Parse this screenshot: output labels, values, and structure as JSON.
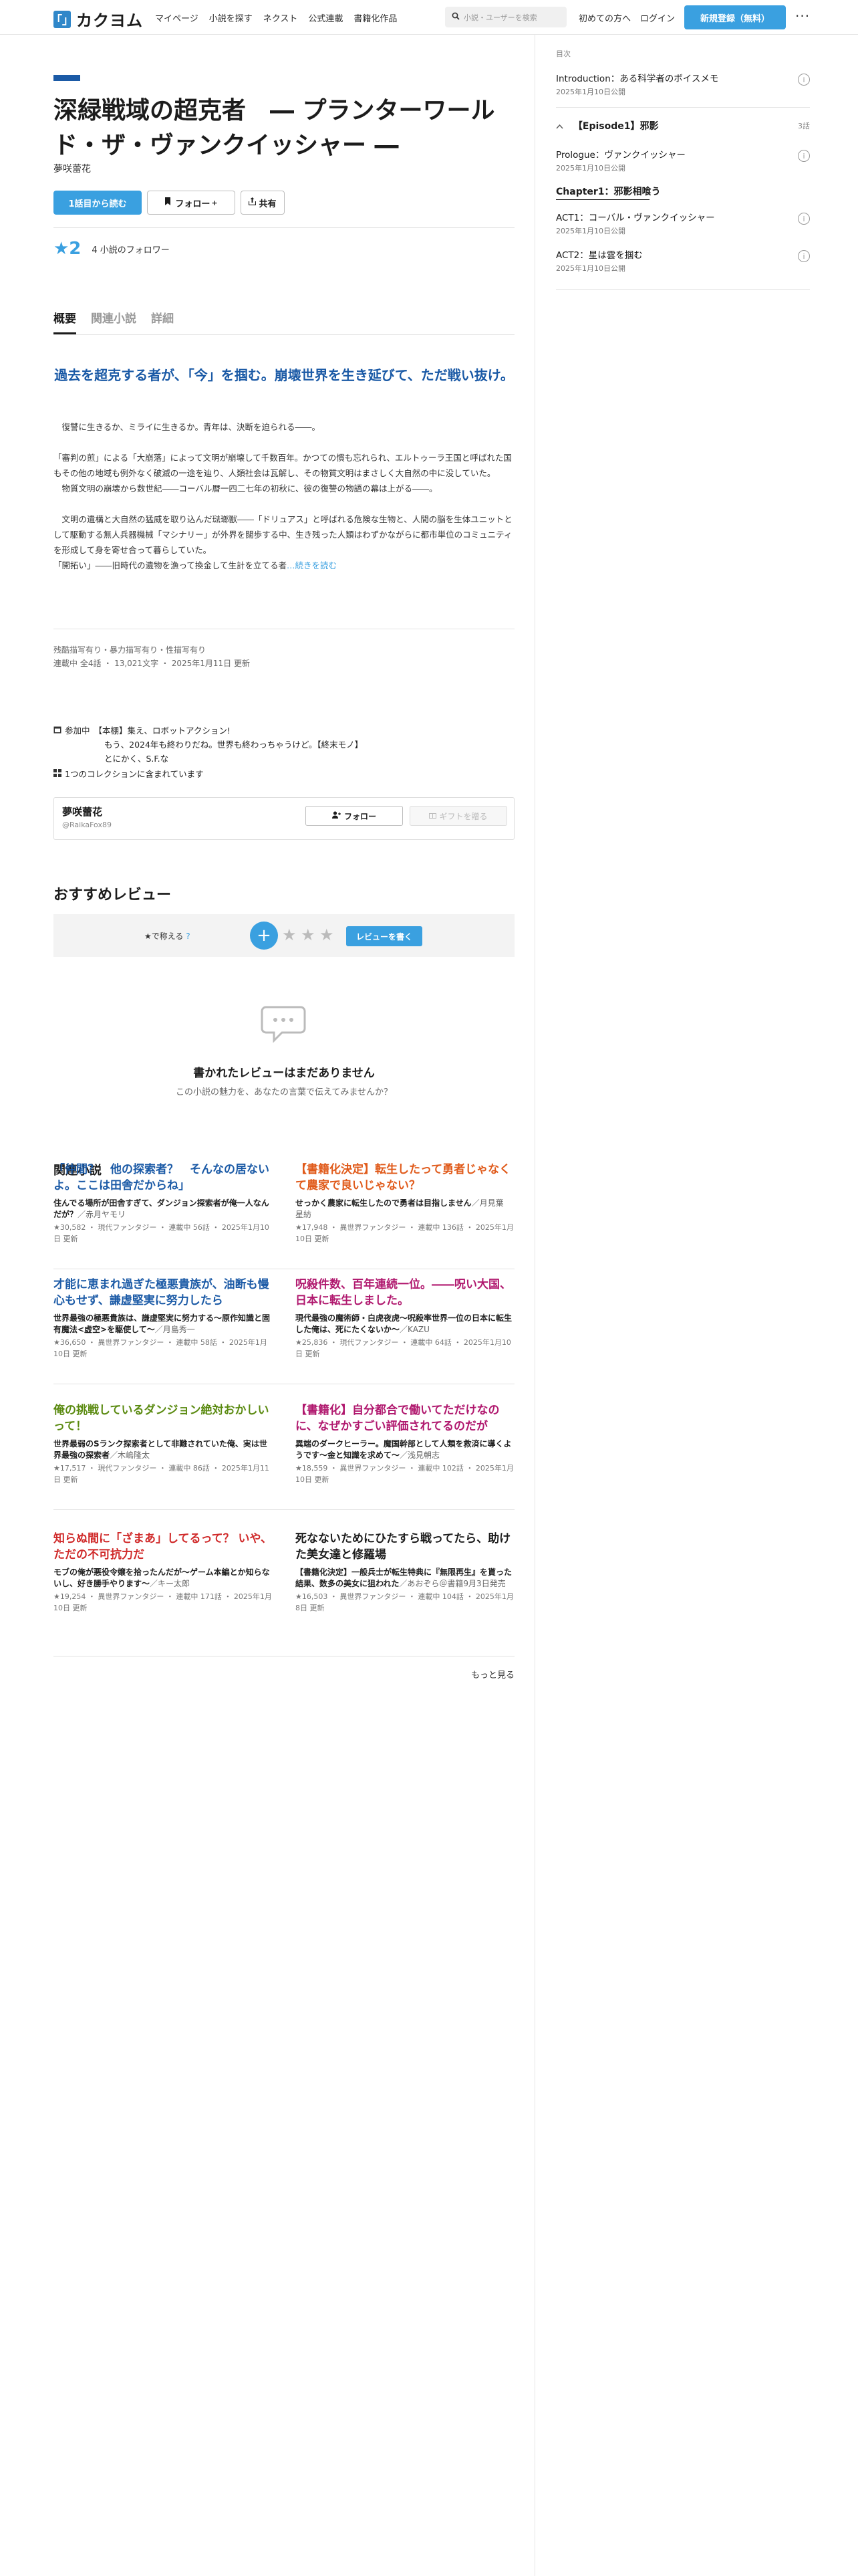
{
  "header": {
    "logo_mark": "「」",
    "logo_text": "カクヨム",
    "nav": [
      "マイページ",
      "小説を探す",
      "ネクスト",
      "公式連載",
      "書籍化作品"
    ],
    "search_placeholder": "小説・ユーザーを検索",
    "beginner": "初めての方へ",
    "login": "ログイン",
    "register": "新規登録（無料）",
    "more": "···"
  },
  "work": {
    "title": "深緑戦域の超克者　― プランターワールド・ザ・ヴァンクイッシャー ―",
    "author": "夢咲蕾花",
    "read_first": "1話目から読む",
    "follow": "フォロー",
    "share": "共有",
    "stars": "★2",
    "followers": "4 小説のフォロワー"
  },
  "tabs": [
    "概要",
    "関連小説",
    "詳細"
  ],
  "catchphrase": "過去を超克する者が、「今」を掴む。崩壊世界を生き延びて、ただ戦い抜け。",
  "intro": [
    "　復讐に生きるか、ミライに生きるか。青年は、決断を迫られる――。",
    "「審判の煎」による「大崩落」によって文明が崩壊して千数百年。かつての慣も忘れられ、エルトゥーラ王国と呼ばれた国もその他の地域も例外なく破滅の一途を辿り、人類社会は瓦解し、その物質文明はまさしく大自然の中に没していた。\n　物質文明の崩壊から数世紀――コーバル暦一四二七年の初秋に、彼の復讐の物語の幕は上がる――。",
    "　文明の遺構と大自然の猛威を取り込んだ琺瑯獣――「ドリュアス」と呼ばれる危険な生物と、人間の脳を生体ユニットとして駆動する無人兵器機械「マシナリー」が外界を闊歩する中、生き残った人類はわずかながらに都市単位のコミュニティを形成して身を寄せ合って暮らしていた。\n「開拓い」――旧時代の遺物を漁って換金して生計を立てる者"
  ],
  "read_more": "…続きを読む",
  "meta": {
    "warnings": "残酷描写有り・暴力描写有り・性描写有り",
    "status": "連載中 全4話 ・ 13,021文字 ・ 2025年1月11日 更新",
    "event_label": "参加中",
    "event_text": "【本棚】集え、ロボットアクション!",
    "event_line2": "もう、2024年も終わりだね。世界も終わっちゃうけど。【終末モノ】",
    "event_line3": "とにかく、S.F.な",
    "collection": "1つのコレクションに含まれています"
  },
  "author_card": {
    "name": "夢咲蕾花",
    "handle": "@RaikaFox89",
    "follow": "フォロー",
    "gift": "ギフトを贈る"
  },
  "reviews": {
    "heading": "おすすめレビュー",
    "label": "★で称える",
    "write": "レビューを書く",
    "empty_title": "書かれたレビューはまだありません",
    "empty_sub": "この小説の魅力を、あなたの言葉で伝えてみませんか？"
  },
  "related": {
    "heading": "関連小説",
    "items": [
      {
        "title": "「仲間？　他の探索者？　そんなの居ないよ。ここは田舎だからね」",
        "color": "#1b5aa6",
        "desc": "住んでる場所が田舎すぎて、ダンジョン探索者が俺一人なんだが？",
        "author": "赤月ヤモリ",
        "meta": "★30,582 ・ 現代ファンタジー ・ 連載中 56話 ・ 2025年1月10日 更新"
      },
      {
        "title": "【書籍化決定】転生したって勇者じゃなくて農家で良いじゃない？",
        "color": "#e05a1a",
        "desc": "せっかく農家に転生したので勇者は目指しません",
        "author": "月見葉　星紡",
        "meta": "★17,948 ・ 異世界ファンタジー ・ 連載中 136話 ・ 2025年1月10日 更新"
      },
      {
        "title": "才能に恵まれ過ぎた極悪貴族が、油断も慢心もせず、謙虚堅実に努力したら",
        "color": "#1b5aa6",
        "desc": "世界最強の極悪貴族は、謙虚堅実に努力する～原作知識と固有魔法<虚空>を駆使して～",
        "author": "月島秀一",
        "meta": "★36,650 ・ 異世界ファンタジー ・ 連載中 58話 ・ 2025年1月10日 更新"
      },
      {
        "title": "呪殺件数、百年連続一位。――呪い大国、日本に転生しました。",
        "color": "#b0186e",
        "desc": "現代最強の魔術師・白虎夜虎～呪殺率世界一位の日本に転生した俺は、死にたくないか～",
        "author": "KAZU",
        "meta": "★25,836 ・ 現代ファンタジー ・ 連載中 64話 ・ 2025年1月10日 更新"
      },
      {
        "title": "俺の挑戦しているダンジョン絶対おかしいって！",
        "color": "#5a8a10",
        "desc": "世界最弱のSランク探索者として非難されていた俺、実は世界最強の探索者",
        "author": "木嶋隆太",
        "meta": "★17,517 ・ 現代ファンタジー ・ 連載中 86話 ・ 2025年1月11日 更新"
      },
      {
        "title": "【書籍化】自分都合で働いてただけなのに、なぜかすごい評価されてるのだが",
        "color": "#b0186e",
        "desc": "異端のダークヒーラー。魔国幹部として人類を救済に導くようです～金と知識を求めて～",
        "author": "浅見朝志",
        "meta": "★18,559 ・ 異世界ファンタジー ・ 連載中 102話 ・ 2025年1月10日 更新"
      },
      {
        "title": "知らぬ間に「ざまあ」してるって？ いや、ただの不可抗力だ",
        "color": "#d02a2a",
        "desc": "モブの俺が悪役令嬢を拾ったんだが～ゲーム本編とか知らないし、好き勝手やります～",
        "author": "キー太郎",
        "meta": "★19,254 ・ 異世界ファンタジー ・ 連載中 171話 ・ 2025年1月10日 更新"
      },
      {
        "title": "死なないためにひたすら戦ってたら、助けた美女達と修羅場",
        "color": "#1c1c1c",
        "desc": "【書籍化決定】一般兵士が転生特典に『無限再生』を貰った結果、数多の美女に狙われた",
        "author": "あおぞら＠書籍9月3日発売",
        "meta": "★16,503 ・ 異世界ファンタジー ・ 連載中 104話 ・ 2025年1月8日 更新"
      }
    ],
    "see_more": "もっと見る"
  },
  "sidebar": {
    "toc_label": "目次",
    "intro_ep": {
      "title": "Introduction：ある科学者のボイスメモ",
      "date": "2025年1月10日公開"
    },
    "chapter1": {
      "title": "【Episode1】邪影",
      "count": "3話"
    },
    "prologue": {
      "title": "Prologue：ヴァンクイッシャー",
      "date": "2025年1月10日公開"
    },
    "sub_chapter": "Chapter1：邪影相喰う",
    "act1": {
      "title": "ACT1：コーバル・ヴァンクイッシャー",
      "date": "2025年1月10日公開"
    },
    "act2": {
      "title": "ACT2：星は雲を掴む",
      "date": "2025年1月10日公開"
    }
  }
}
